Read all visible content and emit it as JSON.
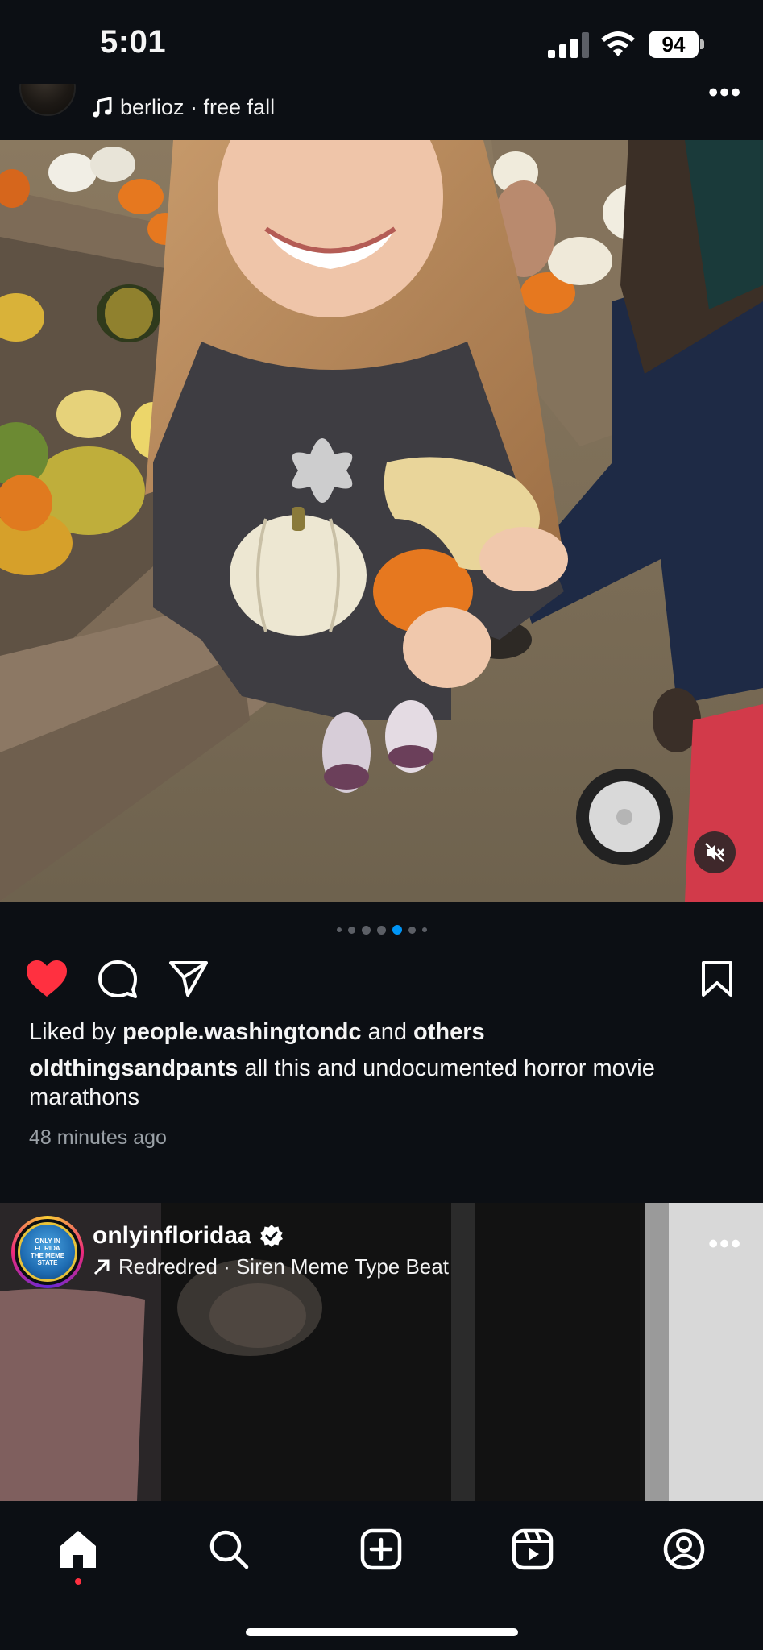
{
  "status_bar": {
    "time": "5:01",
    "battery": "94"
  },
  "post1": {
    "username_partial": "oldthingsandpants",
    "audio": "berlioz · free fall",
    "carousel": {
      "count": 7,
      "active_index": 4
    },
    "likes": {
      "prefix": "Liked by ",
      "user": "people.washingtondc",
      "middle": " and ",
      "others": "others"
    },
    "caption": {
      "username": "oldthingsandpants",
      "text": " all this and undocumented horror movie marathons"
    },
    "time_ago": "48 minutes ago",
    "liked": true
  },
  "post2": {
    "username": "onlyinfloridaa",
    "verified": true,
    "audio": "Redredred · Siren Meme Type Beat",
    "avatar_text": [
      "ONLY IN",
      "FL RIDA",
      "THE MEME STATE"
    ]
  },
  "icons": {
    "like": "heart-filled-icon",
    "comment": "comment-bubble-icon",
    "share": "paper-plane-icon",
    "save": "bookmark-icon",
    "mute": "speaker-muted-icon"
  },
  "tabs": [
    "home",
    "search",
    "create",
    "reels",
    "profile"
  ],
  "colors": {
    "like": "#ff3040",
    "active_dot": "#0095f6",
    "background": "#0c0f14"
  }
}
